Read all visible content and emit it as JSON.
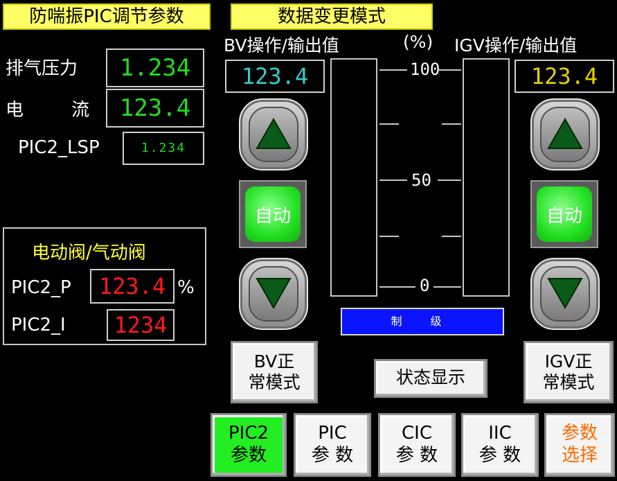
{
  "header": {
    "title": "防喘振PIC调节参数",
    "mode": "数据变更模式"
  },
  "readings": {
    "exhaust_pressure_label": "排气压力",
    "exhaust_pressure_value": "1.234",
    "current_label_a": "电",
    "current_label_b": "流",
    "current_value": "123.4",
    "lsp_label": "PIC2_LSP",
    "lsp_value": "1.234"
  },
  "valve_panel": {
    "title": "电动阀/气动阀",
    "p_label": "PIC2_P",
    "p_value": "123.4",
    "p_unit": "%",
    "i_label": "PIC2_I",
    "i_value": "1234"
  },
  "bv": {
    "title": "BV操作/输出值",
    "value": "123.4",
    "auto_label": "自动",
    "mode_line1": "BV正",
    "mode_line2": "常模式"
  },
  "scale": {
    "unit": "(%)",
    "labels": [
      "100",
      "50",
      "0"
    ]
  },
  "igv": {
    "title": "IGV操作/输出值",
    "value": "123.4",
    "auto_label": "自动",
    "mode_line1": "IGV正",
    "mode_line2": "常模式"
  },
  "status": {
    "indicator_text": "制 级",
    "display_button": "状态显示"
  },
  "tabs": [
    {
      "line1": "PIC2",
      "line2": "参数"
    },
    {
      "line1": "PIC",
      "line2": "参 数"
    },
    {
      "line1": "CIC",
      "line2": "参 数"
    },
    {
      "line1": "IIC",
      "line2": "参 数"
    },
    {
      "line1": "参数",
      "line2": "选择"
    }
  ],
  "colors": {
    "value_green": "#22dd22",
    "value_cyan": "#33cccc",
    "value_yellow": "#e8d000",
    "value_red": "#ff1a1a",
    "header_yellow": "#ffff66",
    "auto_green": "#22e022",
    "tab_active": "#22ee22",
    "tab_orange": "#ff6a00",
    "status_blue": "#0a14ff"
  },
  "icons": {
    "up": "triangle-up-icon",
    "down": "triangle-down-icon"
  }
}
